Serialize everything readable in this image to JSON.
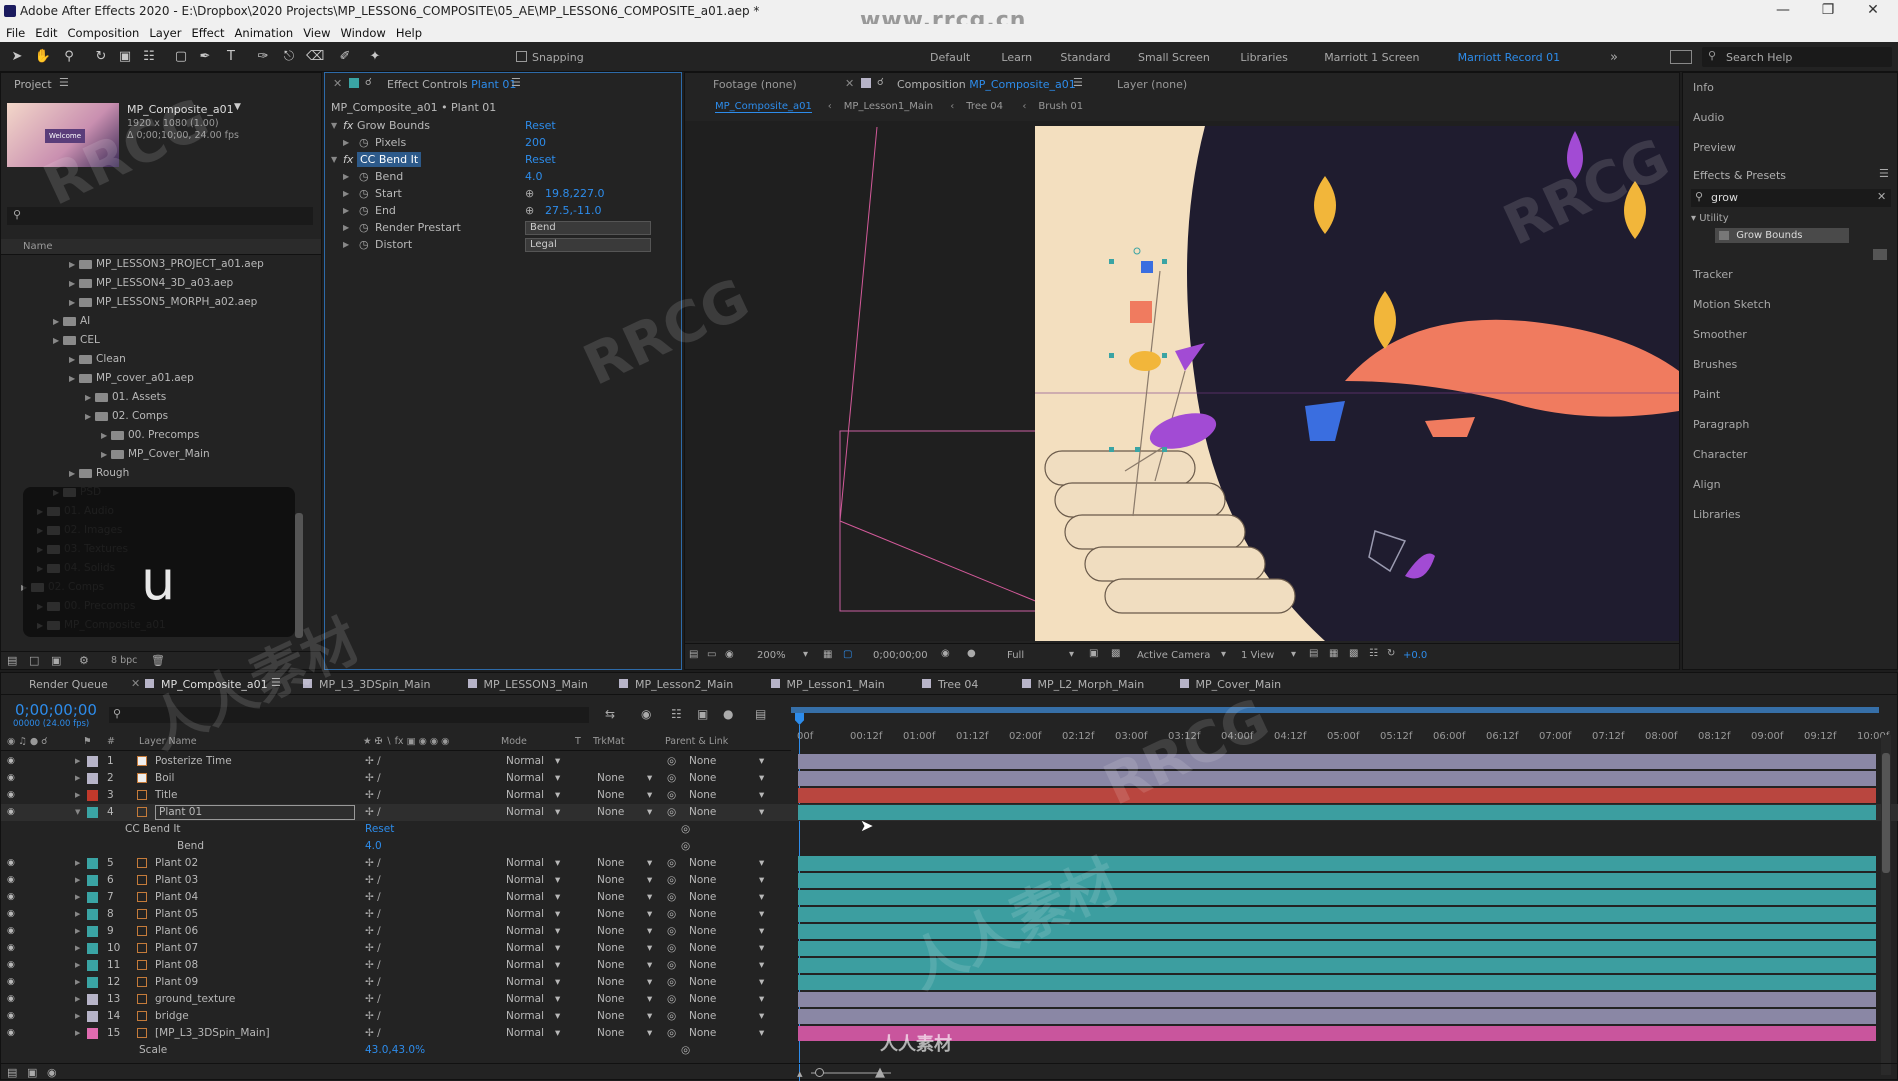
{
  "window": {
    "title": "Adobe After Effects 2020 - E:\\Dropbox\\2020 Projects\\MP_LESSON6_COMPOSITE\\05_AE\\MP_LESSON6_COMPOSITE_a01.aep *",
    "watermark_url": "www.rrcg.cn",
    "watermark_text": "RRCG",
    "watermark_cn": "人人素材"
  },
  "menu": [
    "File",
    "Edit",
    "Composition",
    "Layer",
    "Effect",
    "Animation",
    "View",
    "Window",
    "Help"
  ],
  "toolbar": {
    "snapping": "Snapping",
    "workspaces": [
      "Default",
      "Learn",
      "Standard",
      "Small Screen",
      "Libraries",
      "Marriott 1 Screen",
      "Marriott Record 01"
    ],
    "search_help": "Search Help"
  },
  "project": {
    "tab": "Project",
    "comp_name": "MP_Composite_a01",
    "comp_size": "1920 x 1080 (1.00)",
    "comp_duration": "Δ 0;00;10;00, 24.00 fps",
    "thumb_text": "Welcome",
    "col_name": "Name",
    "items": [
      {
        "label": "MP_LESSON3_PROJECT_a01.aep",
        "indent": 3,
        "dim": false
      },
      {
        "label": "MP_LESSON4_3D_a03.aep",
        "indent": 3,
        "dim": false
      },
      {
        "label": "MP_LESSON5_MORPH_a02.aep",
        "indent": 3,
        "dim": false
      },
      {
        "label": "AI",
        "indent": 2,
        "dim": false
      },
      {
        "label": "CEL",
        "indent": 2,
        "dim": false
      },
      {
        "label": "Clean",
        "indent": 3,
        "dim": false
      },
      {
        "label": "MP_cover_a01.aep",
        "indent": 3,
        "dim": false
      },
      {
        "label": "01. Assets",
        "indent": 4,
        "dim": false
      },
      {
        "label": "02. Comps",
        "indent": 4,
        "dim": false
      },
      {
        "label": "00. Precomps",
        "indent": 5,
        "dim": false
      },
      {
        "label": "MP_Cover_Main",
        "indent": 5,
        "dim": false
      },
      {
        "label": "Rough",
        "indent": 3,
        "dim": false
      },
      {
        "label": "PSD",
        "indent": 2,
        "dim": true
      },
      {
        "label": "01. Audio",
        "indent": 1,
        "dim": true
      },
      {
        "label": "02. Images",
        "indent": 1,
        "dim": true
      },
      {
        "label": "03. Textures",
        "indent": 1,
        "dim": true
      },
      {
        "label": "04. Solids",
        "indent": 1,
        "dim": true
      },
      {
        "label": "02. Comps",
        "indent": 0,
        "dim": true
      },
      {
        "label": "00. Precomps",
        "indent": 1,
        "dim": true
      },
      {
        "label": "MP_Composite_a01",
        "indent": 1,
        "dim": true
      }
    ],
    "bpc": "8 bpc",
    "overlay_letter": "u"
  },
  "effect_controls": {
    "tab_prefix": "Effect Controls",
    "tab_layer": "Plant 01",
    "header": "MP_Composite_a01 • Plant 01",
    "rows": [
      {
        "label": "Grow Bounds",
        "value": "Reset",
        "fx": true,
        "indent": 0
      },
      {
        "label": "Pixels",
        "value": "200",
        "fx": false,
        "indent": 1
      },
      {
        "label": "CC Bend It",
        "value": "Reset",
        "fx": true,
        "indent": 0,
        "highlight": true
      },
      {
        "label": "Bend",
        "value": "4.0",
        "fx": false,
        "indent": 1
      },
      {
        "label": "Start",
        "value": "19.8,227.0",
        "fx": false,
        "indent": 1,
        "point": true
      },
      {
        "label": "End",
        "value": "27.5,-11.0",
        "fx": false,
        "indent": 1,
        "point": true
      },
      {
        "label": "Render Prestart",
        "value": "Bend",
        "fx": false,
        "indent": 1,
        "dropdown": true
      },
      {
        "label": "Distort",
        "value": "Legal",
        "fx": false,
        "indent": 1,
        "dropdown": true
      }
    ]
  },
  "composition": {
    "footage_tab": "Footage (none)",
    "comp_tab_prefix": "Composition",
    "comp_tab_name": "MP_Composite_a01",
    "layer_tab": "Layer (none)",
    "breadcrumbs": [
      "MP_Composite_a01",
      "MP_Lesson1_Main",
      "Tree 04",
      "Brush 01"
    ],
    "zoom": "200%",
    "timecode": "0;00;00;00",
    "resolution": "Full",
    "camera": "Active Camera",
    "views": "1 View",
    "exposure": "+0.0"
  },
  "right_panel": {
    "items": [
      "Info",
      "Audio",
      "Preview"
    ],
    "effects_title": "Effects & Presets",
    "search_value": "grow",
    "category": "Utility",
    "result": "Grow Bounds",
    "items2": [
      "Tracker",
      "Motion Sketch",
      "Smoother",
      "Brushes",
      "Paint",
      "Paragraph",
      "Character",
      "Align",
      "Libraries"
    ]
  },
  "timeline": {
    "tabs": [
      "Render Queue",
      "MP_Composite_a01",
      "MP_L3_3DSpin_Main",
      "MP_LESSON3_Main",
      "MP_Lesson2_Main",
      "MP_Lesson1_Main",
      "Tree 04",
      "MP_L2_Morph_Main",
      "MP_Cover_Main"
    ],
    "active_tab": 1,
    "timecode": "0;00;00;00",
    "frame_info": "00000 (24.00 fps)",
    "headers": {
      "num": "#",
      "layer_name": "Layer Name",
      "mode": "Mode",
      "t": "T",
      "trkmat": "TrkMat",
      "parent": "Parent & Link"
    },
    "ruler": [
      "00f",
      "00:12f",
      "01:00f",
      "01:12f",
      "02:00f",
      "02:12f",
      "03:00f",
      "03:12f",
      "04:00f",
      "04:12f",
      "05:00f",
      "05:12f",
      "06:00f",
      "06:12f",
      "07:00f",
      "07:12f",
      "08:00f",
      "08:12f",
      "09:00f",
      "09:12f",
      "10:00f"
    ],
    "layers": [
      {
        "num": "1",
        "name": "Posterize Time",
        "color": "#b7b4c8",
        "mode": "Normal",
        "trk": "",
        "parent": "None",
        "bar": "#8a87a5",
        "icon": "solid"
      },
      {
        "num": "2",
        "name": "Boil",
        "color": "#b7b4c8",
        "mode": "Normal",
        "trk": "None",
        "parent": "None",
        "bar": "#8a87a5",
        "icon": "solid"
      },
      {
        "num": "3",
        "name": "Title",
        "color": "#c0392b",
        "mode": "Normal",
        "trk": "None",
        "parent": "None",
        "bar": "#b9463f",
        "icon": "ai"
      },
      {
        "num": "4",
        "name": "Plant 01",
        "color": "#3aa4a4",
        "mode": "Normal",
        "trk": "None",
        "parent": "None",
        "bar": "#3c9ea0",
        "icon": "ai",
        "selected": true
      },
      {
        "num": "5",
        "name": "Plant 02",
        "color": "#3aa4a4",
        "mode": "Normal",
        "trk": "None",
        "parent": "None",
        "bar": "#3c9ea0",
        "icon": "ai"
      },
      {
        "num": "6",
        "name": "Plant 03",
        "color": "#3aa4a4",
        "mode": "Normal",
        "trk": "None",
        "parent": "None",
        "bar": "#3c9ea0",
        "icon": "ai"
      },
      {
        "num": "7",
        "name": "Plant 04",
        "color": "#3aa4a4",
        "mode": "Normal",
        "trk": "None",
        "parent": "None",
        "bar": "#3c9ea0",
        "icon": "ai"
      },
      {
        "num": "8",
        "name": "Plant 05",
        "color": "#3aa4a4",
        "mode": "Normal",
        "trk": "None",
        "parent": "None",
        "bar": "#3c9ea0",
        "icon": "ai"
      },
      {
        "num": "9",
        "name": "Plant 06",
        "color": "#3aa4a4",
        "mode": "Normal",
        "trk": "None",
        "parent": "None",
        "bar": "#3c9ea0",
        "icon": "ai"
      },
      {
        "num": "10",
        "name": "Plant 07",
        "color": "#3aa4a4",
        "mode": "Normal",
        "trk": "None",
        "parent": "None",
        "bar": "#3c9ea0",
        "icon": "ai"
      },
      {
        "num": "11",
        "name": "Plant 08",
        "color": "#3aa4a4",
        "mode": "Normal",
        "trk": "None",
        "parent": "None",
        "bar": "#3c9ea0",
        "icon": "ai"
      },
      {
        "num": "12",
        "name": "Plant 09",
        "color": "#3aa4a4",
        "mode": "Normal",
        "trk": "None",
        "parent": "None",
        "bar": "#3c9ea0",
        "icon": "ai"
      },
      {
        "num": "13",
        "name": "ground_texture",
        "color": "#b7b4c8",
        "mode": "Normal",
        "trk": "None",
        "parent": "None",
        "bar": "#8a87a5",
        "icon": "ai"
      },
      {
        "num": "14",
        "name": "bridge",
        "color": "#b7b4c8",
        "mode": "Normal",
        "trk": "None",
        "parent": "None",
        "bar": "#8a87a5",
        "icon": "ai"
      },
      {
        "num": "15",
        "name": "[MP_L3_3DSpin_Main]",
        "color": "#e06bb0",
        "mode": "Normal",
        "trk": "None",
        "parent": "None",
        "bar": "#c9559d",
        "icon": "comp"
      }
    ],
    "effect_row": {
      "label": "CC Bend It",
      "value": "Reset"
    },
    "bend_row": {
      "label": "Bend",
      "value": "4.0"
    },
    "scale_row": {
      "label": "Scale",
      "value": "43.0,43.0%"
    }
  }
}
